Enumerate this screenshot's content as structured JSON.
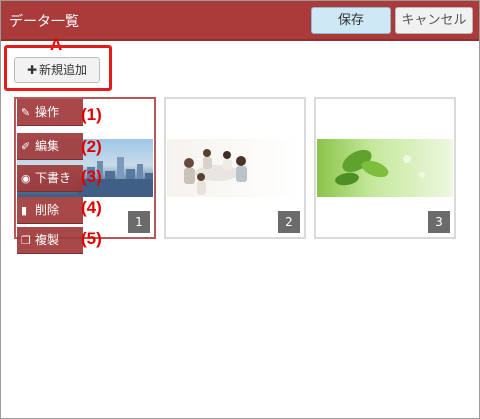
{
  "window": {
    "title": "データ一覧",
    "save_label": "保存",
    "cancel_label": "キャンセル"
  },
  "annotations": {
    "letter": "A",
    "numbers": [
      "(1)",
      "(2)",
      "(3)",
      "(4)",
      "(5)"
    ],
    "color": "#e00000"
  },
  "toolbar": {
    "add_icon": "plus-icon",
    "add_label": "新規追加"
  },
  "menu": {
    "items": [
      {
        "label": "操作",
        "icon": "pencil-icon"
      },
      {
        "label": "編集",
        "icon": "edit-icon"
      },
      {
        "label": "下書き",
        "icon": "eye-icon"
      },
      {
        "label": "削除",
        "icon": "trash-icon"
      },
      {
        "label": "複製",
        "icon": "copy-icon"
      }
    ]
  },
  "cards": [
    {
      "number": "1",
      "image": "city-skyline"
    },
    {
      "number": "2",
      "image": "family-group"
    },
    {
      "number": "3",
      "image": "green-leaves"
    }
  ],
  "colors": {
    "titlebar": "#ab3b3b",
    "save_button": "#cfe8f5",
    "menu": "#a03a3a",
    "highlight": "#e31b1b"
  }
}
